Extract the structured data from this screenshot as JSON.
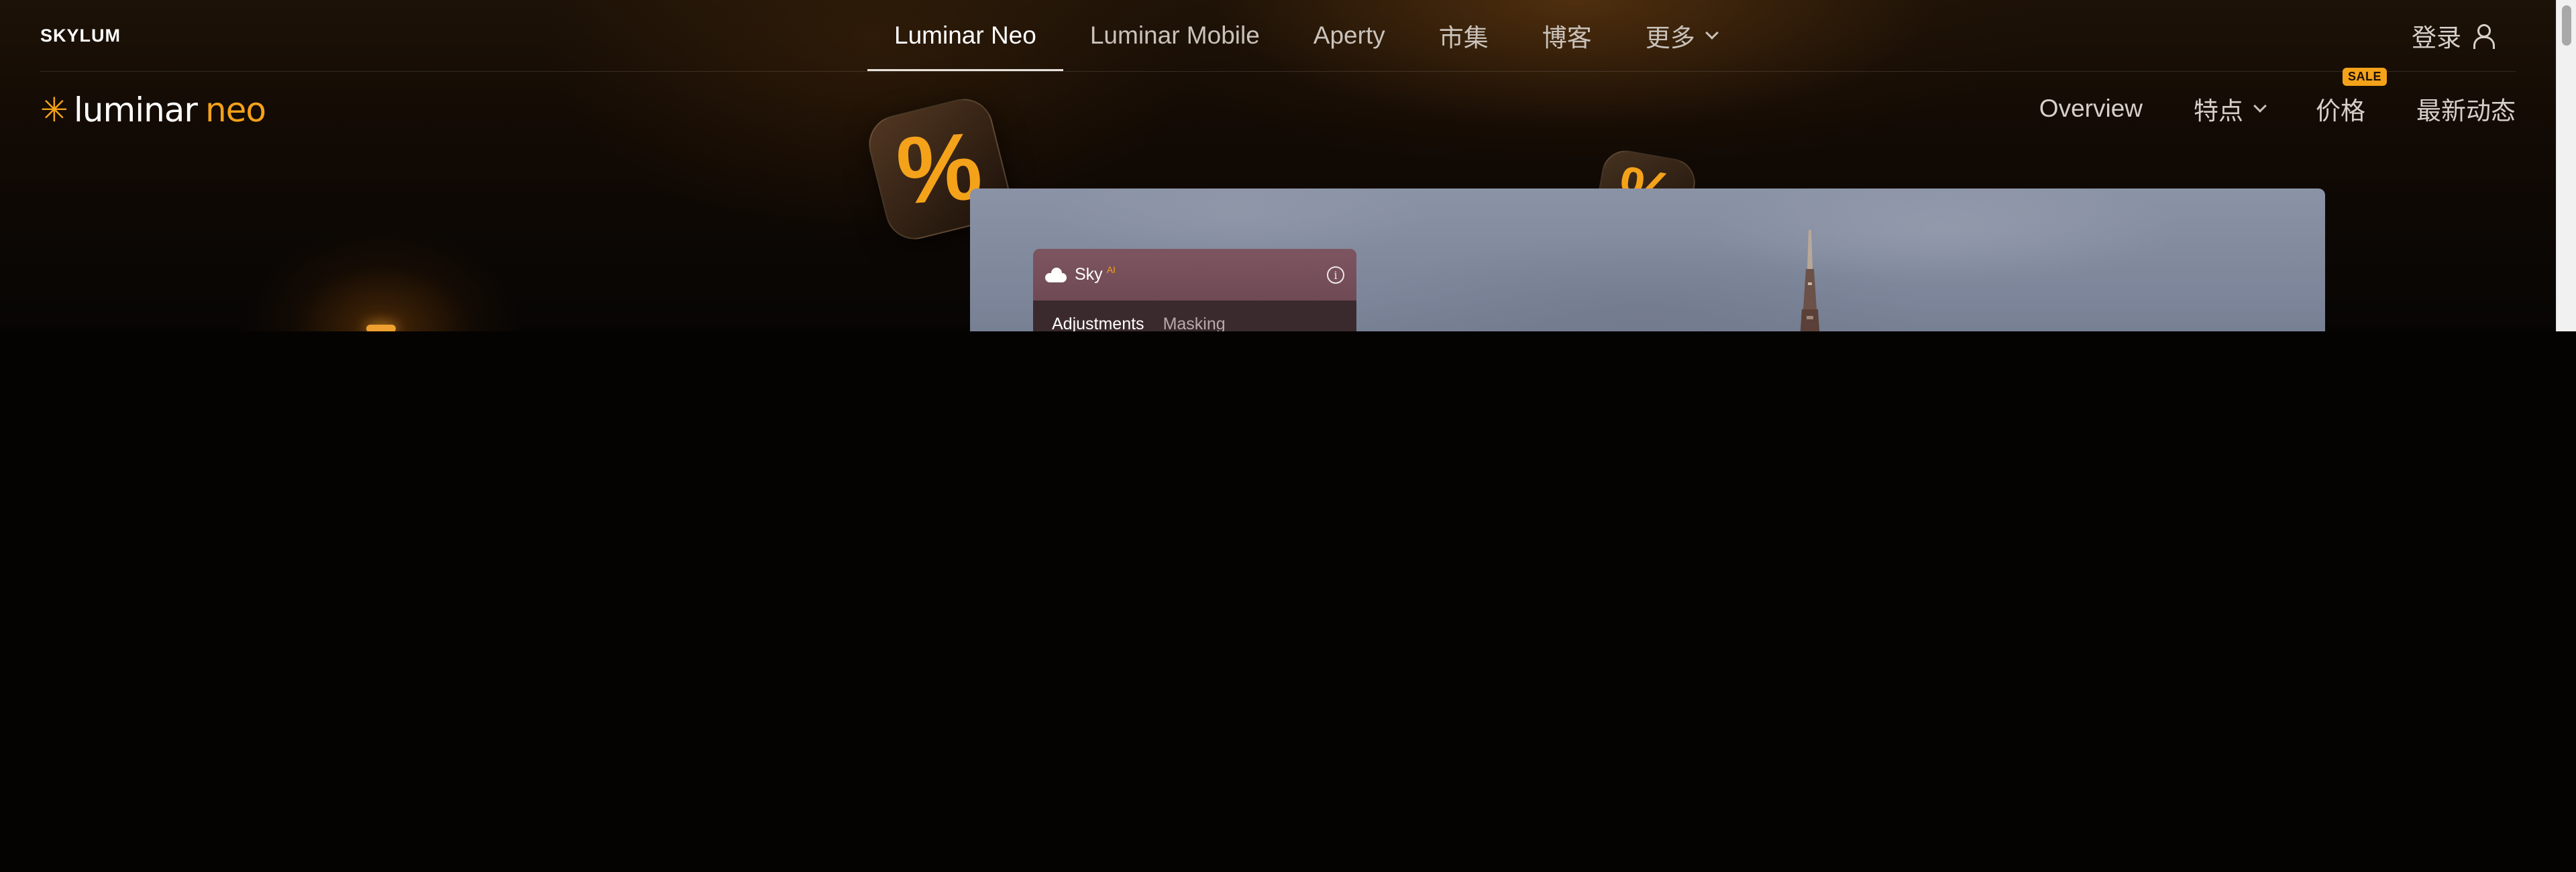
{
  "global_nav": {
    "brand": "SKYLUM",
    "links": [
      {
        "label": "Luminar Neo",
        "active": true
      },
      {
        "label": "Luminar Mobile",
        "active": false
      },
      {
        "label": "Aperty",
        "active": false
      },
      {
        "label": "市集",
        "active": false
      },
      {
        "label": "博客",
        "active": false
      }
    ],
    "more_label": "更多",
    "login_label": "登录"
  },
  "product_nav": {
    "logo_part1": "luminar",
    "logo_part2": "neo",
    "links": {
      "overview": "Overview",
      "features": "特点",
      "pricing": "价格",
      "news": "最新动态"
    },
    "sale_badge": "SALE"
  },
  "hero": {
    "decor_symbol": "%",
    "panel": {
      "title": "Sky",
      "ai_tag": "AI",
      "info": "i",
      "tabs": [
        "Adjustments",
        "Masking"
      ]
    }
  },
  "colors": {
    "accent": "#f4a21a",
    "background": "#060403",
    "text": "#d8d2cc"
  },
  "icons": [
    "user-icon",
    "chevron-down-icon",
    "cloud-icon",
    "info-icon",
    "sun-star-icon"
  ]
}
